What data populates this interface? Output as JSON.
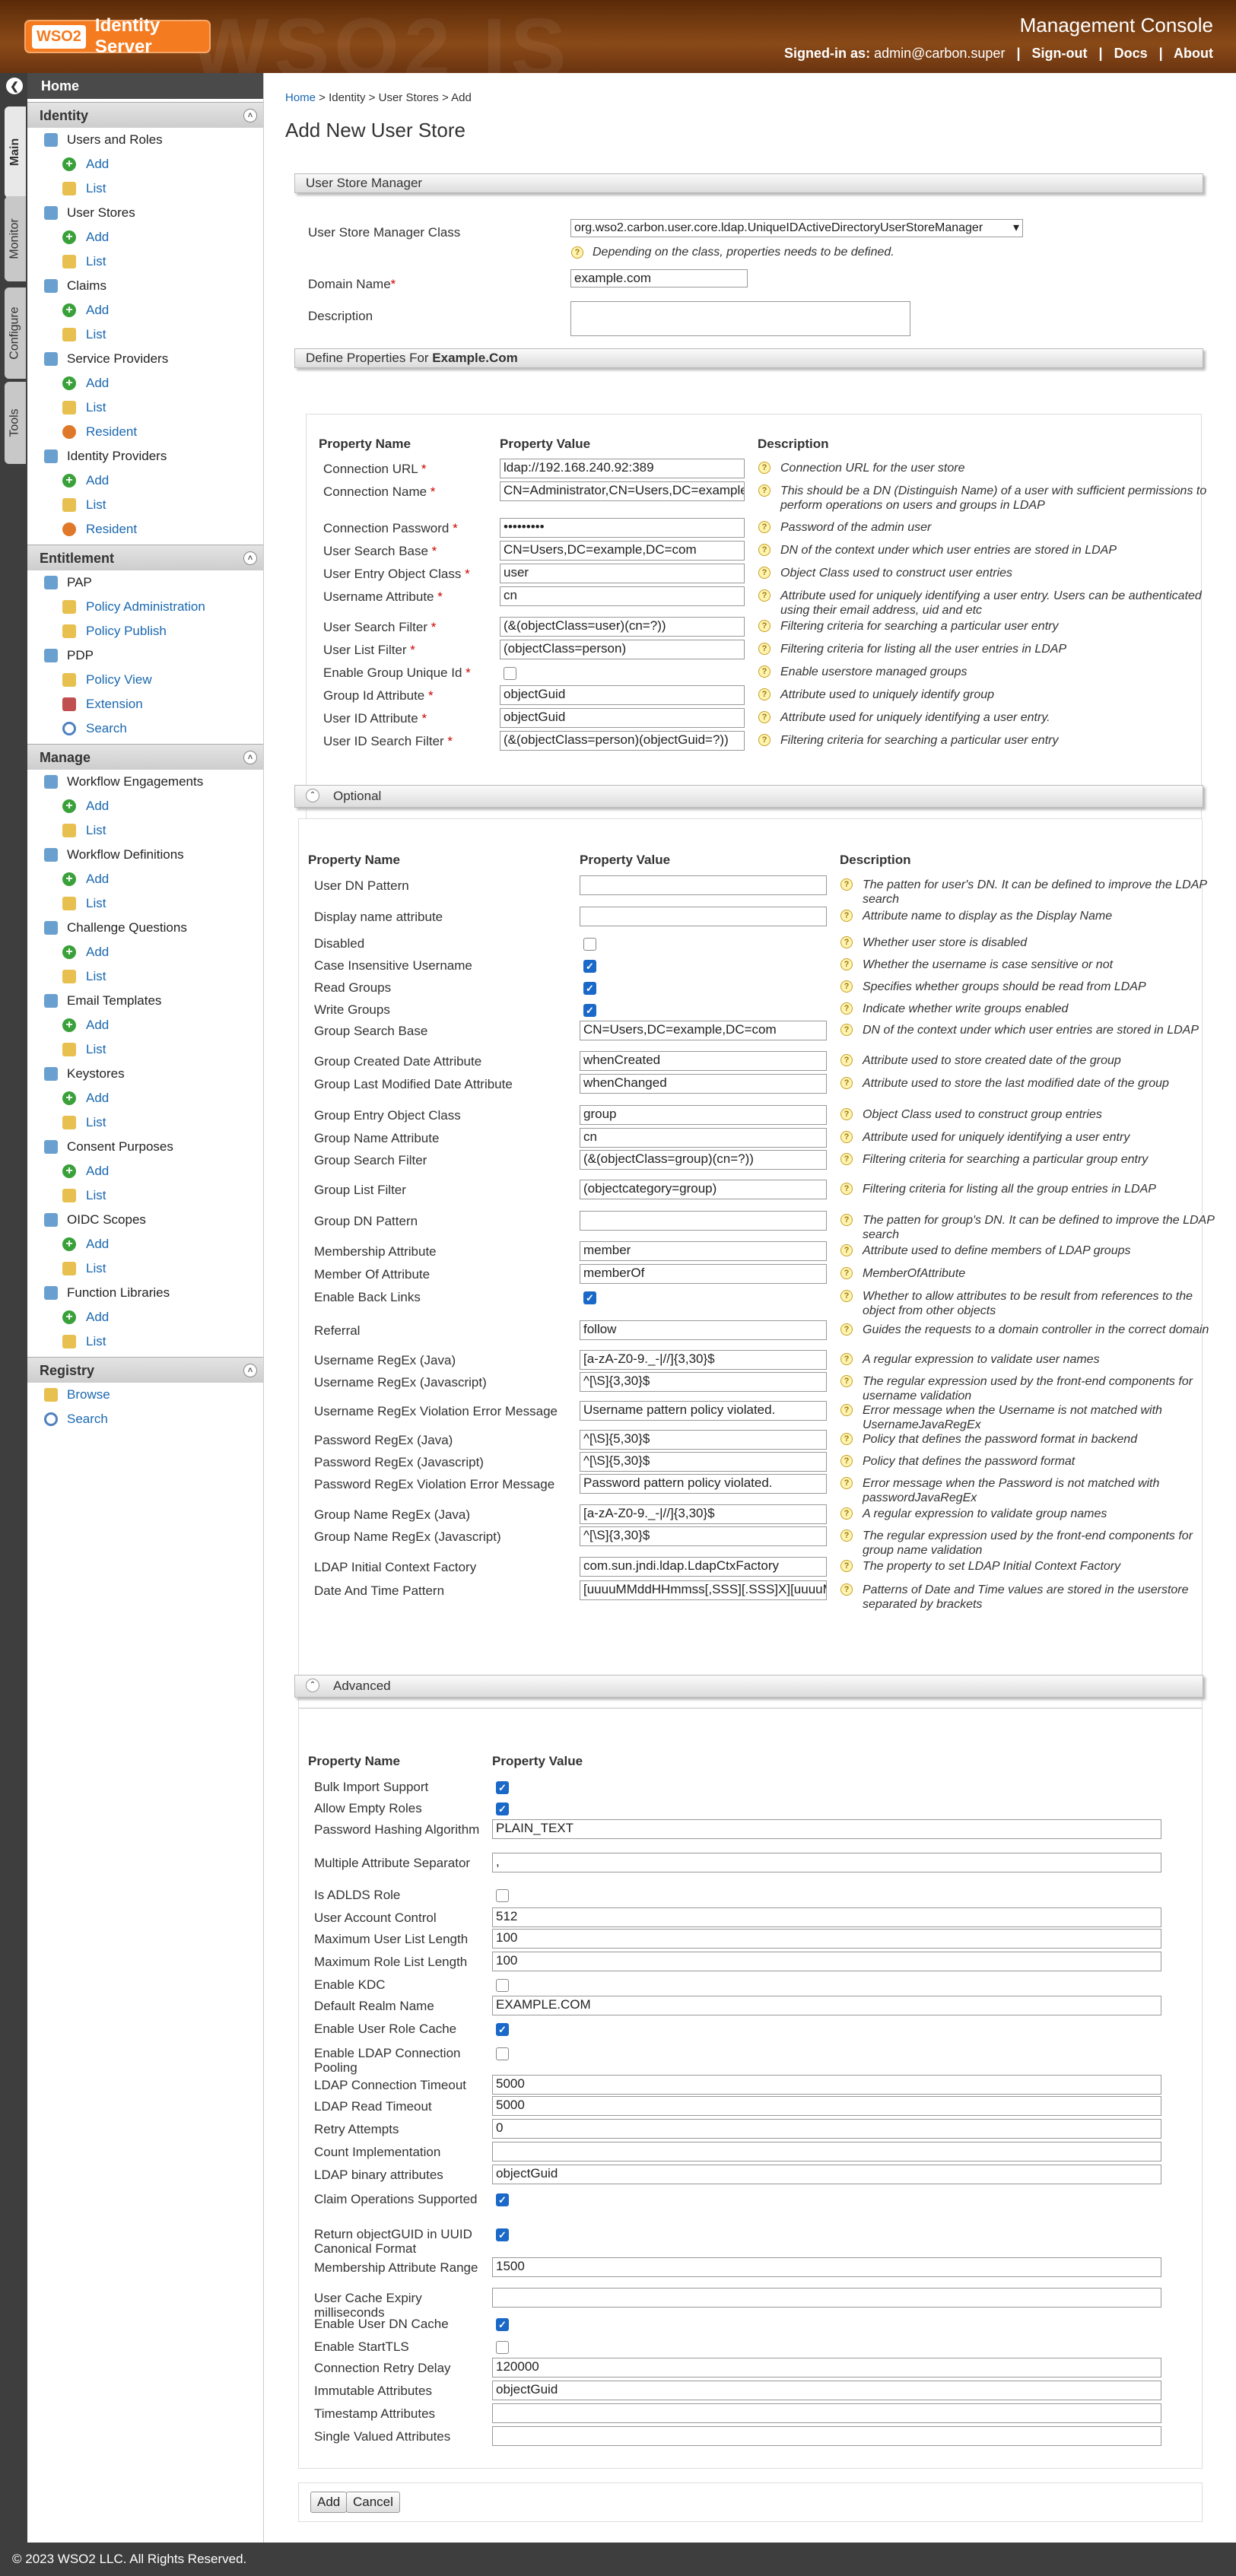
{
  "header": {
    "product_badge": "WSO2",
    "product_name": "Identity Server",
    "console_title": "Management Console",
    "signed_in_label": "Signed-in as:",
    "signed_in_user": "admin@carbon.super",
    "sign_out": "Sign-out",
    "docs": "Docs",
    "about": "About"
  },
  "vtabs": [
    "Main",
    "Monitor",
    "Configure",
    "Tools"
  ],
  "sidebar": {
    "home": "Home",
    "sections": [
      {
        "title": "Identity",
        "items": [
          {
            "label": "Users and Roles",
            "children": [
              "Add",
              "List"
            ]
          },
          {
            "label": "User Stores",
            "children": [
              "Add",
              "List"
            ]
          },
          {
            "label": "Claims",
            "children": [
              "Add",
              "List"
            ]
          },
          {
            "label": "Service Providers",
            "children": [
              "Add",
              "List",
              "Resident"
            ]
          },
          {
            "label": "Identity Providers",
            "children": [
              "Add",
              "List",
              "Resident"
            ]
          }
        ]
      },
      {
        "title": "Entitlement",
        "items": [
          {
            "label": "PAP",
            "children": [
              "Policy Administration",
              "Policy Publish"
            ]
          },
          {
            "label": "PDP",
            "children": [
              "Policy View",
              "Extension",
              "Search"
            ]
          }
        ]
      },
      {
        "title": "Manage",
        "items": [
          {
            "label": "Workflow Engagements",
            "children": [
              "Add",
              "List"
            ]
          },
          {
            "label": "Workflow Definitions",
            "children": [
              "Add",
              "List"
            ]
          },
          {
            "label": "Challenge Questions",
            "children": [
              "Add",
              "List"
            ]
          },
          {
            "label": "Email Templates",
            "children": [
              "Add",
              "List"
            ]
          },
          {
            "label": "Keystores",
            "children": [
              "Add",
              "List"
            ]
          },
          {
            "label": "Consent Purposes",
            "children": [
              "Add",
              "List"
            ]
          },
          {
            "label": "OIDC Scopes",
            "children": [
              "Add",
              "List"
            ]
          },
          {
            "label": "Function Libraries",
            "children": [
              "Add",
              "List"
            ]
          }
        ]
      },
      {
        "title": "Registry",
        "items": [],
        "links": [
          "Browse",
          "Search"
        ]
      }
    ]
  },
  "breadcrumb": {
    "home": "Home",
    "sep": " > ",
    "identity": "Identity",
    "user_stores": "User Stores",
    "current": "Add"
  },
  "page_title": "Add New User Store",
  "usm": {
    "bar": "User Store Manager",
    "class_label": "User Store Manager Class",
    "class_value": "org.wso2.carbon.user.core.ldap.UniqueIDActiveDirectoryUserStoreManager",
    "class_hint": "Depending on the class, properties needs to be defined.",
    "domain_label": "Domain Name",
    "domain_value": "example.com",
    "desc_label": "Description",
    "desc_value": ""
  },
  "define": {
    "prefix": "Define Properties For ",
    "domain": "Example.Com"
  },
  "headers": {
    "name": "Property Name",
    "value": "Property Value",
    "desc": "Description"
  },
  "required": [
    {
      "name": "Connection URL",
      "req": true,
      "type": "text",
      "value": "ldap://192.168.240.92:389",
      "desc": "Connection URL for the user store"
    },
    {
      "name": "Connection Name",
      "req": true,
      "type": "text",
      "value": "CN=Administrator,CN=Users,DC=example,DC=com",
      "desc": "This should be a DN (Distinguish Name) of a user with sufficient permissions to perform operations on users and groups in LDAP"
    },
    {
      "name": "Connection Password",
      "req": true,
      "type": "text",
      "value": "•••••••••",
      "desc": "Password of the admin user"
    },
    {
      "name": "User Search Base",
      "req": true,
      "type": "text",
      "value": "CN=Users,DC=example,DC=com",
      "desc": "DN of the context under which user entries are stored in LDAP"
    },
    {
      "name": "User Entry Object Class",
      "req": true,
      "type": "text",
      "value": "user",
      "desc": "Object Class used to construct user entries"
    },
    {
      "name": "Username Attribute",
      "req": true,
      "type": "text",
      "value": "cn",
      "desc": "Attribute used for uniquely identifying a user entry. Users can be authenticated using their email address, uid and etc"
    },
    {
      "name": "User Search Filter",
      "req": true,
      "type": "text",
      "value": "(&(objectClass=user)(cn=?))",
      "desc": "Filtering criteria for searching a particular user entry"
    },
    {
      "name": "User List Filter",
      "req": true,
      "type": "text",
      "value": "(objectClass=person)",
      "desc": "Filtering criteria for listing all the user entries in LDAP"
    },
    {
      "name": "Enable Group Unique Id",
      "req": true,
      "type": "check",
      "value": "",
      "checked": false,
      "desc": "Enable userstore managed groups"
    },
    {
      "name": "Group Id Attribute",
      "req": true,
      "type": "text",
      "value": "objectGuid",
      "desc": "Attribute used to uniquely identify group"
    },
    {
      "name": "User ID Attribute",
      "req": true,
      "type": "text",
      "value": "objectGuid",
      "desc": "Attribute used for uniquely identifying a user entry."
    },
    {
      "name": "User ID Search Filter",
      "req": true,
      "type": "text",
      "value": "(&(objectClass=person)(objectGuid=?))",
      "desc": "Filtering criteria for searching a particular user entry"
    }
  ],
  "optional": {
    "title": "Optional",
    "rows": [
      {
        "name": "User DN Pattern",
        "type": "text",
        "value": "",
        "desc": "The patten for user's DN. It can be defined to improve the LDAP search"
      },
      {
        "name": "Display name attribute",
        "type": "text",
        "value": "",
        "desc": "Attribute name to display as the Display Name"
      },
      {
        "name": "Disabled",
        "type": "check",
        "checked": false,
        "value": "",
        "desc": "Whether user store is disabled"
      },
      {
        "name": "Case Insensitive Username",
        "type": "check",
        "checked": true,
        "value": "",
        "desc": "Whether the username is case sensitive or not"
      },
      {
        "name": "Read Groups",
        "type": "check",
        "checked": true,
        "value": "",
        "desc": "Specifies whether groups should be read from LDAP"
      },
      {
        "name": "Write Groups",
        "type": "check",
        "checked": true,
        "value": "",
        "desc": "Indicate whether write groups enabled"
      },
      {
        "name": "Group Search Base",
        "type": "text",
        "value": "CN=Users,DC=example,DC=com",
        "desc": "DN of the context under which user entries are stored in LDAP"
      },
      {
        "name": "Group Created Date Attribute",
        "type": "text",
        "value": "whenCreated",
        "desc": "Attribute used to store created date of the group"
      },
      {
        "name": "Group Last Modified Date Attribute",
        "type": "text",
        "value": "whenChanged",
        "desc": "Attribute used to store the last modified date of the group"
      },
      {
        "name": "Group Entry Object Class",
        "type": "text",
        "value": "group",
        "desc": "Object Class used to construct group entries"
      },
      {
        "name": "Group Name Attribute",
        "type": "text",
        "value": "cn",
        "desc": "Attribute used for uniquely identifying a user entry"
      },
      {
        "name": "Group Search Filter",
        "type": "text",
        "value": "(&(objectClass=group)(cn=?))",
        "desc": "Filtering criteria for searching a particular group entry"
      },
      {
        "name": "Group List Filter",
        "type": "text",
        "value": "(objectcategory=group)",
        "desc": "Filtering criteria for listing all the group entries in LDAP"
      },
      {
        "name": "Group DN Pattern",
        "type": "text",
        "value": "",
        "desc": "The patten for group's DN. It can be defined to improve the LDAP search"
      },
      {
        "name": "Membership Attribute",
        "type": "text",
        "value": "member",
        "desc": "Attribute used to define members of LDAP groups"
      },
      {
        "name": "Member Of Attribute",
        "type": "text",
        "value": "memberOf",
        "desc": "MemberOfAttribute"
      },
      {
        "name": "Enable Back Links",
        "type": "check",
        "checked": true,
        "value": "",
        "desc": "Whether to allow attributes to be result from references to the object from other objects"
      },
      {
        "name": "Referral",
        "type": "text",
        "value": "follow",
        "desc": "Guides the requests to a domain controller in the correct domain"
      },
      {
        "name": "Username RegEx (Java)",
        "type": "text",
        "value": "[a-zA-Z0-9._-|//]{3,30}$",
        "desc": "A regular expression to validate user names"
      },
      {
        "name": "Username RegEx (Javascript)",
        "type": "text",
        "value": "^[\\S]{3,30}$",
        "desc": "The regular expression used by the front-end components for username validation"
      },
      {
        "name": "Username RegEx Violation Error Message",
        "type": "text",
        "value": "Username pattern policy violated.",
        "desc": "Error message when the Username is not matched with UsernameJavaRegEx"
      },
      {
        "name": "Password RegEx (Java)",
        "type": "text",
        "value": "^[\\S]{5,30}$",
        "desc": "Policy that defines the password format in backend"
      },
      {
        "name": "Password RegEx (Javascript)",
        "type": "text",
        "value": "^[\\S]{5,30}$",
        "desc": "Policy that defines the password format"
      },
      {
        "name": "Password RegEx Violation Error Message",
        "type": "text",
        "value": "Password pattern policy violated.",
        "desc": "Error message when the Password is not matched with passwordJavaRegEx"
      },
      {
        "name": "Group Name RegEx (Java)",
        "type": "text",
        "value": "[a-zA-Z0-9._-|//]{3,30}$",
        "desc": "A regular expression to validate group names"
      },
      {
        "name": "Group Name RegEx (Javascript)",
        "type": "text",
        "value": "^[\\S]{3,30}$",
        "desc": "The regular expression used by the front-end components for group name validation"
      },
      {
        "name": "LDAP Initial Context Factory",
        "type": "text",
        "value": "com.sun.jndi.ldap.LdapCtxFactory",
        "desc": "The property to set LDAP Initial Context Factory"
      },
      {
        "name": "Date And Time Pattern",
        "type": "text",
        "value": "[uuuuMMddHHmmss[,SSS][.SSS]X][uuuuMMddHHmmss[.SSS]X]",
        "desc": "Patterns of Date and Time values are stored in the userstore separated by brackets"
      }
    ]
  },
  "advanced": {
    "title": "Advanced",
    "rows": [
      {
        "name": "Bulk Import Support",
        "type": "check",
        "checked": true,
        "value": ""
      },
      {
        "name": "Allow Empty Roles",
        "type": "check",
        "checked": true,
        "value": ""
      },
      {
        "name": "Password Hashing Algorithm",
        "type": "text",
        "value": "PLAIN_TEXT"
      },
      {
        "name": "Multiple Attribute Separator",
        "type": "text",
        "value": ","
      },
      {
        "name": "Is ADLDS Role",
        "type": "check",
        "checked": false,
        "value": ""
      },
      {
        "name": "User Account Control",
        "type": "text",
        "value": "512"
      },
      {
        "name": "Maximum User List Length",
        "type": "text",
        "value": "100"
      },
      {
        "name": "Maximum Role List Length",
        "type": "text",
        "value": "100"
      },
      {
        "name": "Enable KDC",
        "type": "check",
        "checked": false,
        "value": ""
      },
      {
        "name": "Default Realm Name",
        "type": "text",
        "value": "EXAMPLE.COM"
      },
      {
        "name": "Enable User Role Cache",
        "type": "check",
        "checked": true,
        "value": ""
      },
      {
        "name": "Enable LDAP Connection Pooling",
        "type": "check",
        "checked": false,
        "value": ""
      },
      {
        "name": "LDAP Connection Timeout",
        "type": "text",
        "value": "5000"
      },
      {
        "name": "LDAP Read Timeout",
        "type": "text",
        "value": "5000"
      },
      {
        "name": "Retry Attempts",
        "type": "text",
        "value": "0"
      },
      {
        "name": "Count Implementation",
        "type": "text",
        "value": ""
      },
      {
        "name": "LDAP binary attributes",
        "type": "text",
        "value": "objectGuid"
      },
      {
        "name": "Claim Operations Supported",
        "type": "check",
        "checked": true,
        "value": ""
      },
      {
        "name": "Return objectGUID in UUID Canonical Format",
        "type": "check",
        "checked": true,
        "value": ""
      },
      {
        "name": "Membership Attribute Range",
        "type": "text",
        "value": "1500"
      },
      {
        "name": "User Cache Expiry milliseconds",
        "type": "text",
        "value": ""
      },
      {
        "name": "Enable User DN Cache",
        "type": "check",
        "checked": true,
        "value": ""
      },
      {
        "name": "Enable StartTLS",
        "type": "check",
        "checked": false,
        "value": ""
      },
      {
        "name": "Connection Retry Delay",
        "type": "text",
        "value": "120000"
      },
      {
        "name": "Immutable Attributes",
        "type": "text",
        "value": "objectGuid"
      },
      {
        "name": "Timestamp Attributes",
        "type": "text",
        "value": ""
      },
      {
        "name": "Single Valued Attributes",
        "type": "text",
        "value": ""
      }
    ]
  },
  "buttons": {
    "add": "Add",
    "cancel": "Cancel"
  },
  "footer": "© 2023 WSO2 LLC. All Rights Reserved."
}
